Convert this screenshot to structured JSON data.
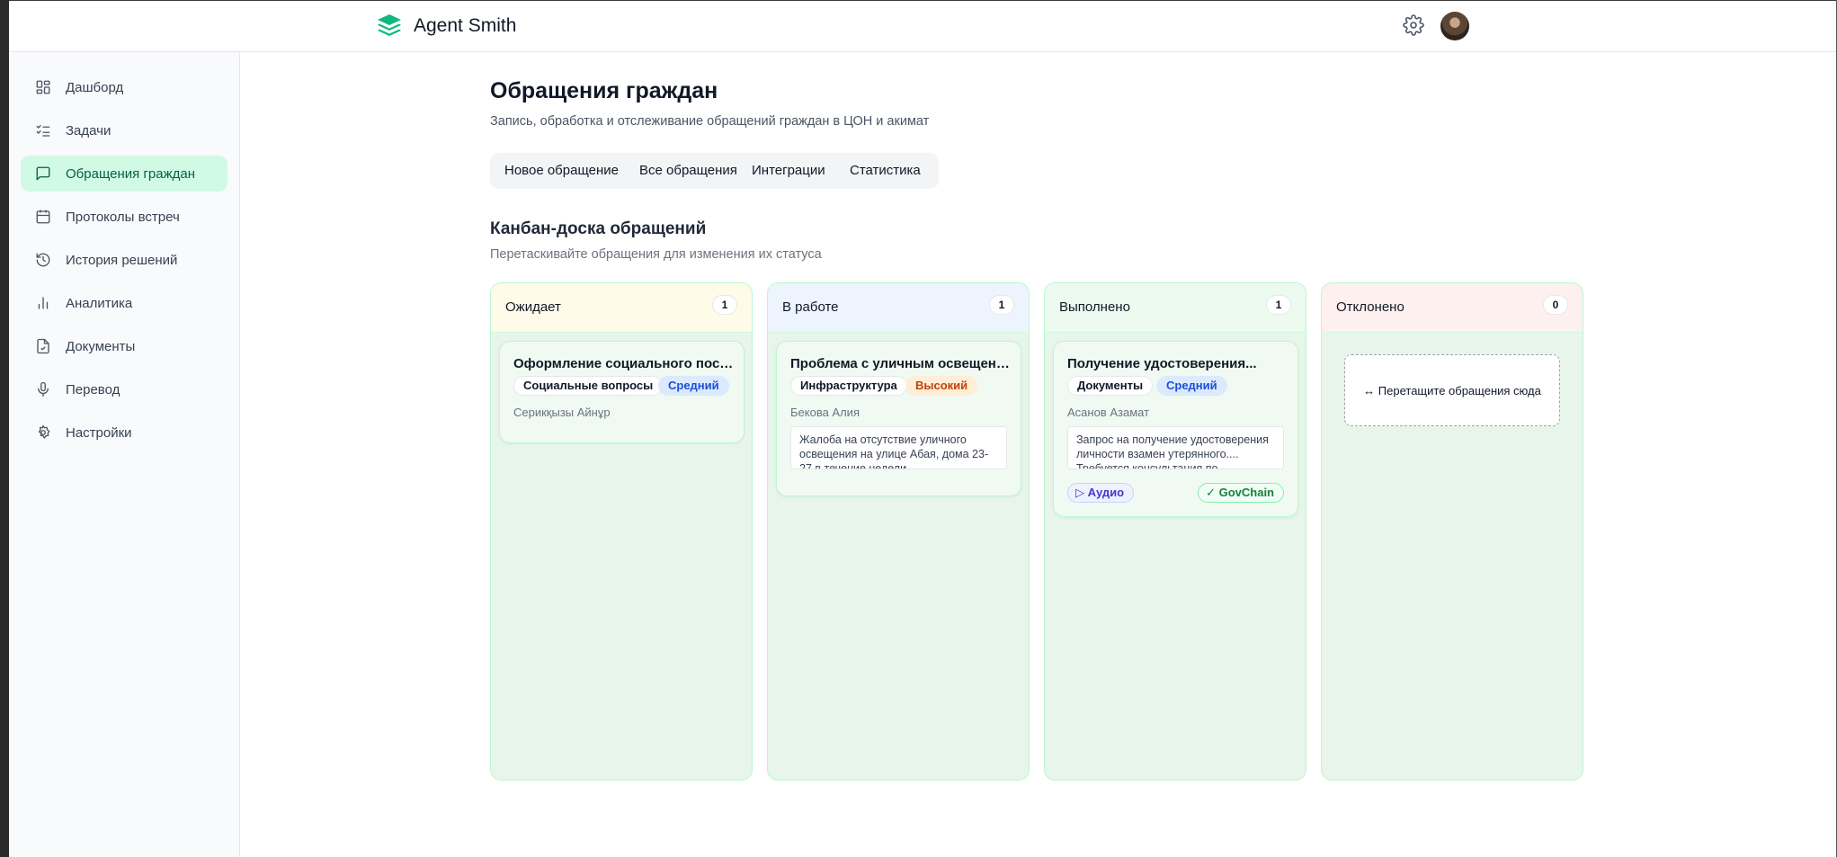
{
  "app": {
    "title": "Agent Smith"
  },
  "sidebar": {
    "items": [
      {
        "label": "Дашборд",
        "icon": "dashboard-icon"
      },
      {
        "label": "Задачи",
        "icon": "tasks-icon"
      },
      {
        "label": "Обращения граждан",
        "icon": "message-icon",
        "active": true
      },
      {
        "label": "Протоколы встреч",
        "icon": "calendar-icon"
      },
      {
        "label": "История решений",
        "icon": "history-icon"
      },
      {
        "label": "Аналитика",
        "icon": "bar-chart-icon"
      },
      {
        "label": "Документы",
        "icon": "document-icon"
      },
      {
        "label": "Перевод",
        "icon": "microphone-icon"
      },
      {
        "label": "Настройки",
        "icon": "gear-icon"
      }
    ]
  },
  "page": {
    "title": "Обращения граждан",
    "subtitle": "Запись, обработка и отслеживание обращений граждан в ЦОН и акимат",
    "tabs": [
      "Новое обращение",
      "Все обращения",
      "Интеграции",
      "Статистика"
    ],
    "active_tab": "Все обращения"
  },
  "board": {
    "title": "Канбан-доска обращений",
    "subtitle": "Перетаскивайте обращения для изменения их статуса",
    "columns": [
      {
        "name": "Ожидает",
        "count": "1",
        "header_color": "#fefbe8",
        "cards": [
          {
            "title": "Оформление социального пособия",
            "category": "Социальные вопросы",
            "priority": "Средний",
            "person": "Серикқызы Айнұр"
          }
        ]
      },
      {
        "name": "В работе",
        "count": "1",
        "header_color": "#eef4fd",
        "cards": [
          {
            "title": "Проблема с уличным освещением",
            "category": "Инфраструктура",
            "priority": "Высокий",
            "person": "Бекова Алия",
            "description": "Жалоба на отсутствие уличного освещения на улице Абая, дома 23-27 в течение недели"
          }
        ]
      },
      {
        "name": "Выполнено",
        "count": "1",
        "header_color": "#ecfaef",
        "cards": [
          {
            "title": "Получение удостоверения...",
            "category": "Документы",
            "priority": "Средний",
            "person": "Асанов Азамат",
            "description": "Запрос на получение удостоверения личности взамен утерянного.... Требуется консультация по",
            "audio_label": "▷ Аудио",
            "govchain_label": "✓ GovChain"
          }
        ]
      },
      {
        "name": "Отклонено",
        "count": "0",
        "header_color": "#fdf0ee",
        "dropzone": "↔  Перетащите обращения сюда"
      }
    ]
  },
  "colors": {
    "accent": "#10b981",
    "active_nav_bg": "#d1fae5",
    "column_bg": "#e8f5ea"
  }
}
